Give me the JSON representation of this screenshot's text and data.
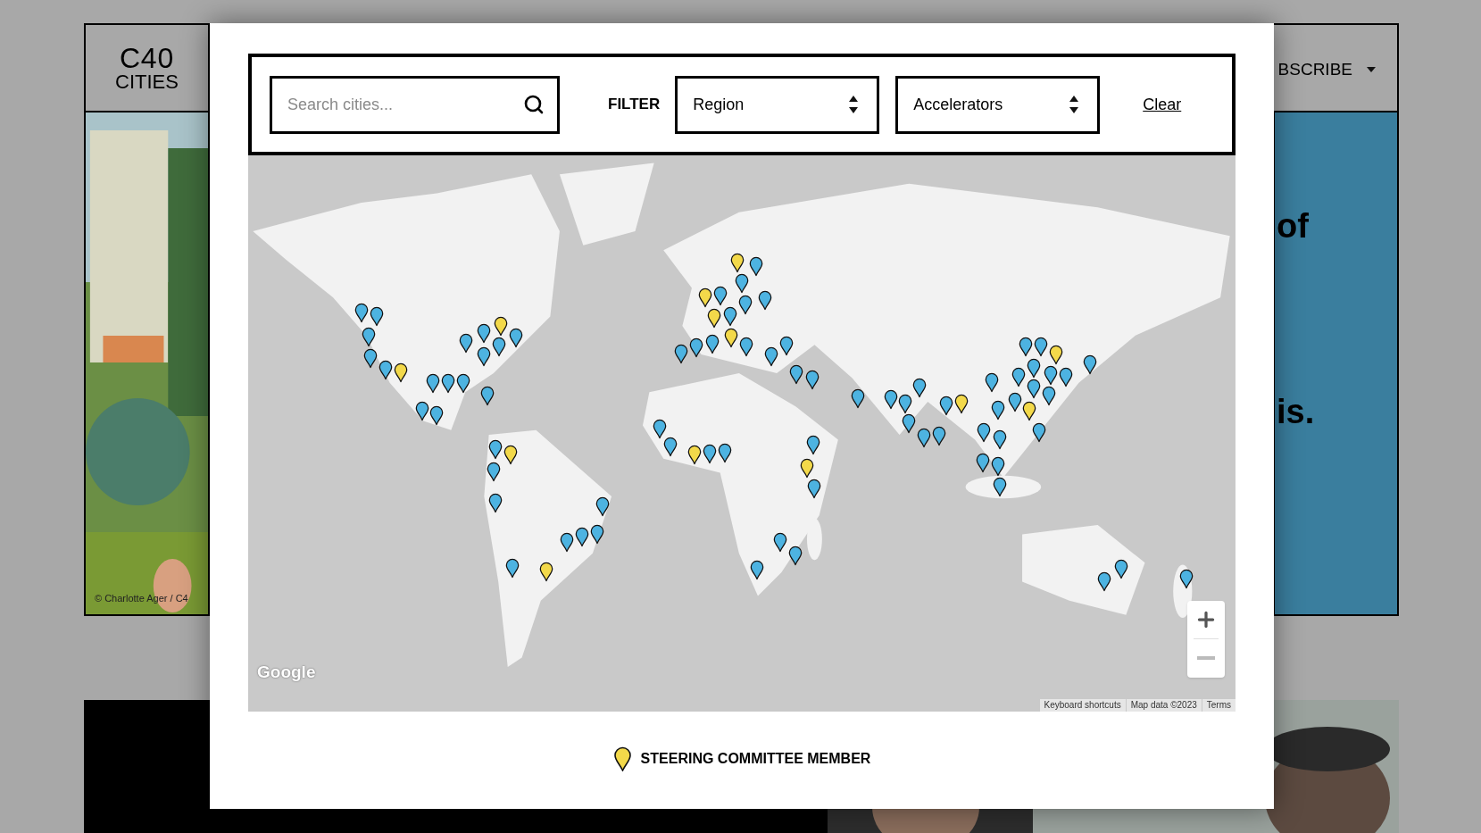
{
  "site": {
    "logo": [
      "C40",
      "CITIES"
    ],
    "nav_item": "BSCRIBE",
    "hero_caption": "© Charlotte Ager / C4",
    "hero_words": [
      "of",
      "is."
    ]
  },
  "modal": {
    "search": {
      "placeholder": "Search cities..."
    },
    "filter_label": "FILTER",
    "selects": [
      {
        "value": "Region"
      },
      {
        "value": "Accelerators"
      }
    ],
    "clear": "Clear",
    "map": {
      "logo": "Google",
      "attribution": [
        "Keyboard shortcuts",
        "Map data ©2023",
        "Terms"
      ],
      "pins": [
        {
          "color": "#4db3e1"
        },
        {
          "color": "#4db3e1"
        },
        {
          "color": "#4db3e1"
        },
        {
          "color": "#4db3e1"
        },
        {
          "color": "#4db3e1"
        },
        {
          "color": "#f3d94a"
        },
        {
          "color": "#4db3e1"
        },
        {
          "color": "#4db3e1"
        },
        {
          "color": "#f3d94a"
        },
        {
          "color": "#4db3e1"
        },
        {
          "color": "#4db3e1"
        },
        {
          "color": "#4db3e1"
        },
        {
          "color": "#4db3e1"
        },
        {
          "color": "#4db3e1"
        },
        {
          "color": "#4db3e1"
        },
        {
          "color": "#4db3e1"
        },
        {
          "color": "#4db3e1"
        },
        {
          "color": "#4db3e1"
        },
        {
          "color": "#4db3e1"
        },
        {
          "color": "#f3d94a"
        },
        {
          "color": "#4db3e1"
        },
        {
          "color": "#4db3e1"
        },
        {
          "color": "#4db3e1"
        },
        {
          "color": "#4db3e1"
        },
        {
          "color": "#4db3e1"
        },
        {
          "color": "#4db3e1"
        },
        {
          "color": "#4db3e1"
        },
        {
          "color": "#f3d94a"
        },
        {
          "color": "#f3d94a"
        },
        {
          "color": "#4db3e1"
        },
        {
          "color": "#4db3e1"
        },
        {
          "color": "#f3d94a"
        },
        {
          "color": "#4db3e1"
        },
        {
          "color": "#4db3e1"
        },
        {
          "color": "#4db3e1"
        },
        {
          "color": "#4db3e1"
        },
        {
          "color": "#f3d94a"
        },
        {
          "color": "#f3d94a"
        },
        {
          "color": "#4db3e1"
        },
        {
          "color": "#4db3e1"
        },
        {
          "color": "#4db3e1"
        },
        {
          "color": "#4db3e1"
        },
        {
          "color": "#4db3e1"
        },
        {
          "color": "#4db3e1"
        },
        {
          "color": "#4db3e1"
        },
        {
          "color": "#4db3e1"
        },
        {
          "color": "#4db3e1"
        },
        {
          "color": "#4db3e1"
        },
        {
          "color": "#f3d94a"
        },
        {
          "color": "#4db3e1"
        },
        {
          "color": "#4db3e1"
        },
        {
          "color": "#4db3e1"
        },
        {
          "color": "#f3d94a"
        },
        {
          "color": "#4db3e1"
        },
        {
          "color": "#4db3e1"
        },
        {
          "color": "#4db3e1"
        },
        {
          "color": "#4db3e1"
        },
        {
          "color": "#4db3e1"
        },
        {
          "color": "#4db3e1"
        },
        {
          "color": "#4db3e1"
        },
        {
          "color": "#4db3e1"
        },
        {
          "color": "#4db3e1"
        },
        {
          "color": "#4db3e1"
        },
        {
          "color": "#4db3e1"
        },
        {
          "color": "#4db3e1"
        },
        {
          "color": "#f3d94a"
        },
        {
          "color": "#4db3e1"
        },
        {
          "color": "#4db3e1"
        },
        {
          "color": "#4db3e1"
        },
        {
          "color": "#4db3e1"
        },
        {
          "color": "#4db3e1"
        },
        {
          "color": "#4db3e1"
        },
        {
          "color": "#4db3e1"
        },
        {
          "color": "#4db3e1"
        },
        {
          "color": "#4db3e1"
        },
        {
          "color": "#f3d94a"
        },
        {
          "color": "#4db3e1"
        },
        {
          "color": "#4db3e1"
        },
        {
          "color": "#4db3e1"
        },
        {
          "color": "#4db3e1"
        },
        {
          "color": "#4db3e1"
        },
        {
          "color": "#4db3e1"
        },
        {
          "color": "#4db3e1"
        },
        {
          "color": "#f3d94a"
        },
        {
          "color": "#4db3e1"
        },
        {
          "color": "#4db3e1"
        },
        {
          "color": "#4db3e1"
        },
        {
          "color": "#4db3e1"
        },
        {
          "color": "#4db3e1"
        }
      ]
    },
    "legend": {
      "label": "STEERING COMMITTEE MEMBER",
      "color": "#f3d94a"
    }
  }
}
